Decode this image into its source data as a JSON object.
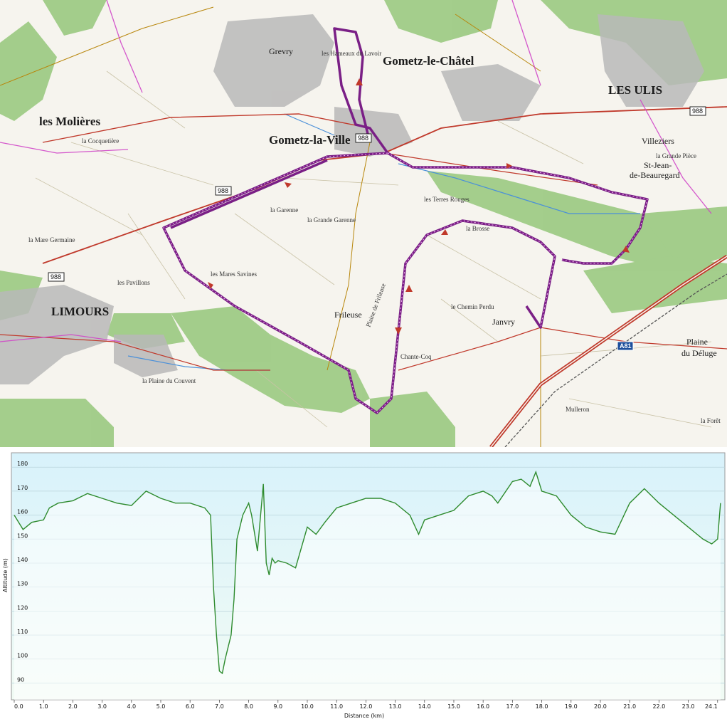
{
  "map": {
    "places": [
      {
        "id": "les-molieres",
        "label": "les Molières",
        "size": "big"
      },
      {
        "id": "gometz-la-ville",
        "label": "Gometz-la-Ville",
        "size": "big"
      },
      {
        "id": "gometz-le-chatel",
        "label": "Gometz-le-Châtel",
        "size": "big"
      },
      {
        "id": "limours",
        "label": "LIMOURS",
        "size": "big"
      },
      {
        "id": "janvry",
        "label": "Janvry",
        "size": "mid"
      },
      {
        "id": "st-jean",
        "label": "St-Jean-",
        "size": "mid"
      },
      {
        "id": "st-jean-2",
        "label": "de-Beauregard",
        "size": "mid"
      },
      {
        "id": "les-ulis",
        "label": "LES ULIS",
        "size": "big"
      },
      {
        "id": "grevry",
        "label": "Grevry",
        "size": "mid"
      },
      {
        "id": "villeziers",
        "label": "Villeziers",
        "size": "mid"
      },
      {
        "id": "frileuse",
        "label": "Frileuse",
        "size": "mid"
      },
      {
        "id": "plaine-deluge",
        "label": "Plaine",
        "size": "mid"
      },
      {
        "id": "plaine-deluge-2",
        "label": "du Déluge",
        "size": "mid"
      },
      {
        "id": "la-grande-garenne",
        "label": "la Grande Garenne",
        "size": "sm"
      },
      {
        "id": "la-garenne",
        "label": "la Garenne",
        "size": "sm"
      },
      {
        "id": "les-mares-savines",
        "label": "les Mares Savines",
        "size": "sm"
      },
      {
        "id": "le-chemin-perdu",
        "label": "le Chemin Perdu",
        "size": "sm"
      },
      {
        "id": "plaine-de-frileuse",
        "label": "Plaine de Frileuse",
        "size": "sm"
      },
      {
        "id": "la-grande-piece",
        "label": "la Grande Pièce",
        "size": "sm"
      },
      {
        "id": "les-terres-rouges",
        "label": "les Terres Rouges",
        "size": "sm"
      },
      {
        "id": "la-brosse",
        "label": "la Brosse",
        "size": "sm"
      },
      {
        "id": "la-plaine-du-couvent",
        "label": "la Plaine du Couvent",
        "size": "sm"
      },
      {
        "id": "les-pavillons",
        "label": "les Pavillons",
        "size": "sm"
      },
      {
        "id": "la-cocquetiere",
        "label": "la Cocquetière",
        "size": "sm"
      },
      {
        "id": "la-mare-germaine",
        "label": "la Mare Germaine",
        "size": "sm"
      },
      {
        "id": "les-hameaux",
        "label": "les Hameaux du Lavoir",
        "size": "sm"
      },
      {
        "id": "chante-coq",
        "label": "Chante-Coq",
        "size": "sm"
      },
      {
        "id": "mulleron",
        "label": "Mulleron",
        "size": "sm"
      },
      {
        "id": "la-foret",
        "label": "la Forêt",
        "size": "sm"
      }
    ],
    "road_labels": [
      "988",
      "988",
      "988",
      "988"
    ],
    "motorway_label": "A81",
    "colors": {
      "route": "#7a1f86",
      "road": "#c0392b",
      "forest": "#8fc07a",
      "water": "#4a90d9",
      "urban": "#9a9a9a"
    }
  },
  "profile": {
    "ylabel": "Altitude (m)",
    "xlabel": "Distance  (km)",
    "line_color": "#2e8b2e",
    "fill_top": "#d8f2fb",
    "fill_bottom": "#f1fbf4"
  },
  "chart_data": {
    "type": "area",
    "xlabel": "Distance  (km)",
    "ylabel": "Altitude (m)",
    "xlim": [
      0,
      24.2
    ],
    "ylim": [
      83,
      186
    ],
    "xticks": [
      "0.0",
      "1.0",
      "2.0",
      "3.0",
      "4.0",
      "5.0",
      "6.0",
      "7.0",
      "8.0",
      "9.0",
      "10.0",
      "11.0",
      "12.0",
      "13.0",
      "14.0",
      "15.0",
      "16.0",
      "17.0",
      "18.0",
      "19.0",
      "20.0",
      "21.0",
      "22.0",
      "23.0",
      "24.1"
    ],
    "yticks": [
      "90",
      "100",
      "110",
      "120",
      "130",
      "140",
      "150",
      "160",
      "170",
      "180"
    ],
    "grid": true,
    "series": [
      {
        "x": [
          0,
          0.3,
          0.6,
          1.0,
          1.2,
          1.5,
          2.0,
          2.5,
          3.0,
          3.5,
          4.0,
          4.5,
          5.0,
          5.5,
          6.0,
          6.5,
          6.7,
          6.8,
          6.9,
          7.0,
          7.1,
          7.2,
          7.3,
          7.4,
          7.5,
          7.6,
          7.8,
          8.0,
          8.1,
          8.3,
          8.5,
          8.6,
          8.7,
          8.8,
          8.9,
          9.0,
          9.3,
          9.6,
          10.0,
          10.3,
          10.6,
          11.0,
          11.5,
          12.0,
          12.5,
          13.0,
          13.5,
          13.8,
          14.0,
          14.5,
          15.0,
          15.5,
          16.0,
          16.3,
          16.5,
          17.0,
          17.3,
          17.6,
          17.8,
          18.0,
          18.5,
          19.0,
          19.5,
          20.0,
          20.5,
          21.0,
          21.5,
          22.0,
          22.5,
          23.0,
          23.5,
          23.8,
          24.0,
          24.1
        ],
        "y": [
          160,
          154,
          157,
          158,
          163,
          165,
          166,
          169,
          167,
          165,
          164,
          170,
          167,
          165,
          165,
          163,
          160,
          130,
          110,
          95,
          94,
          100,
          105,
          110,
          125,
          150,
          160,
          165,
          160,
          145,
          173,
          140,
          135,
          142,
          140,
          141,
          140,
          138,
          155,
          152,
          157,
          163,
          165,
          167,
          167,
          165,
          160,
          152,
          158,
          160,
          162,
          168,
          170,
          168,
          165,
          174,
          175,
          172,
          178,
          170,
          168,
          160,
          155,
          153,
          152,
          165,
          171,
          165,
          160,
          155,
          150,
          148,
          150,
          165
        ]
      }
    ]
  }
}
